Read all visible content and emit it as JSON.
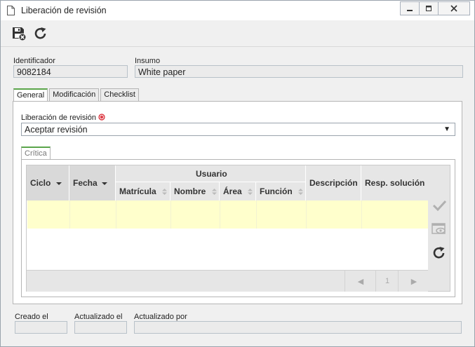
{
  "window": {
    "title": "Liberación de revisión"
  },
  "toolbar": {
    "save_label": "",
    "refresh_label": ""
  },
  "form": {
    "identificador_label": "Identificador",
    "identificador_value": "9082184",
    "insumo_label": "Insumo",
    "insumo_value": "White paper"
  },
  "tabs": [
    {
      "label": "General",
      "active": true
    },
    {
      "label": "Modificación",
      "active": false
    },
    {
      "label": "Checklist",
      "active": false
    }
  ],
  "general": {
    "liberacion_label": "Liberación de revisión",
    "liberacion_value": "Aceptar revisión",
    "dropdown_arrow": "▼",
    "subtab_label": "Crítica"
  },
  "grid": {
    "columns": {
      "ciclo": "Ciclo",
      "fecha": "Fecha",
      "usuario": "Usuario",
      "matricula": "Matrícula",
      "nombre": "Nombre",
      "area": "Área",
      "funcion": "Función",
      "descripcion": "Descripción",
      "resp_solucion": "Resp. solución"
    },
    "pager": {
      "prev": "◀",
      "page": "1",
      "next": "▶"
    }
  },
  "footer": {
    "creado_label": "Creado el",
    "creado_value": "",
    "actualizado_label": "Actualizado el",
    "actualizado_value": "",
    "actualizado_por_label": "Actualizado por",
    "actualizado_por_value": ""
  },
  "colors": {
    "accent_tab": "#5aa54a",
    "highlight_row": "#ffffcc",
    "required": "#d9242f"
  }
}
